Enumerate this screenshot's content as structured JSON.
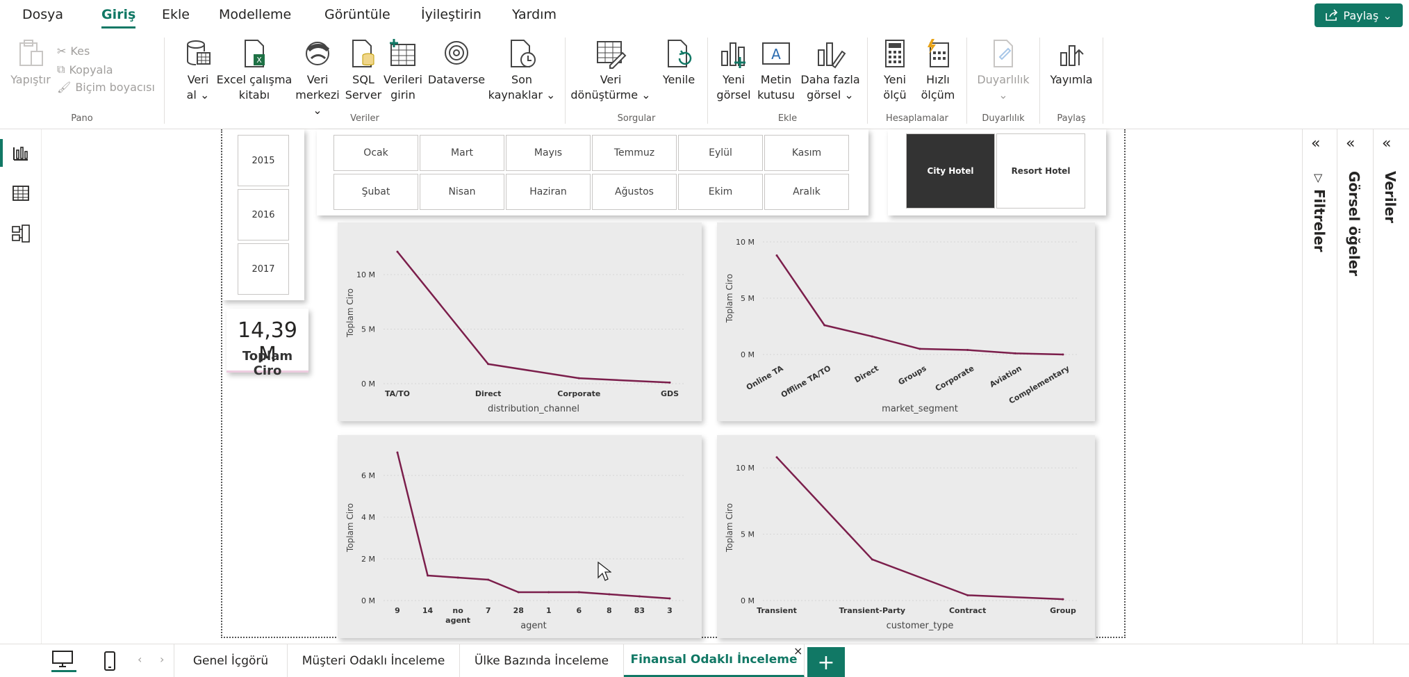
{
  "menu": {
    "items": [
      "Dosya",
      "Giriş",
      "Ekle",
      "Modelleme",
      "Görüntüle",
      "İyileştirin",
      "Yardım"
    ],
    "active_index": 1,
    "share_label": "Paylaş"
  },
  "ribbon": {
    "clipboard": {
      "paste": "Yapıştır",
      "cut": "Kes",
      "copy": "Kopyala",
      "format_painter": "Biçim boyacısı",
      "label": "Pano"
    },
    "data": {
      "get_data": [
        "Veri",
        "al"
      ],
      "excel": [
        "Excel çalışma",
        "kitabı"
      ],
      "hub": [
        "Veri",
        "merkezi"
      ],
      "sql": [
        "SQL",
        "Server"
      ],
      "enter": [
        "Verileri",
        "girin"
      ],
      "dataverse": "Dataverse",
      "recent": [
        "Son",
        "kaynaklar"
      ],
      "label": "Veriler"
    },
    "queries": {
      "transform": [
        "Veri",
        "dönüştürme"
      ],
      "refresh": "Yenile",
      "label": "Sorgular"
    },
    "insert": {
      "new_visual": [
        "Yeni",
        "görsel"
      ],
      "text_box": [
        "Metin",
        "kutusu"
      ],
      "more_visuals": [
        "Daha fazla",
        "görsel"
      ],
      "label": "Ekle"
    },
    "calc": {
      "new_measure": [
        "Yeni",
        "ölçü"
      ],
      "quick_measure": [
        "Hızlı",
        "ölçüm"
      ],
      "label": "Hesaplamalar"
    },
    "sensitivity": {
      "btn": "Duyarlılık",
      "label": "Duyarlılık"
    },
    "share": {
      "publish": "Yayımla",
      "label": "Paylaş"
    }
  },
  "slicers": {
    "years": [
      "2015",
      "2016",
      "2017"
    ],
    "months": [
      "Ocak",
      "Mart",
      "Mayıs",
      "Temmuz",
      "Eylül",
      "Kasım",
      "Şubat",
      "Nisan",
      "Haziran",
      "Ağustos",
      "Ekim",
      "Aralık"
    ],
    "hotels": [
      "City Hotel",
      "Resort Hotel"
    ],
    "selected_hotel": "City Hotel"
  },
  "kpi": {
    "value": "14,39 M",
    "label": "Toplam Ciro"
  },
  "panes": {
    "filters": "Filtreler",
    "visuals": "Görsel öğeler",
    "data": "Veriler"
  },
  "tabs": [
    "Genel İçgörü",
    "Müşteri Odaklı İnceleme",
    "Ülke Bazında İnceleme",
    "Finansal Odaklı İnceleme"
  ],
  "active_tab": 3,
  "colors": {
    "accent": "#117865",
    "line": "#7b1e4b",
    "chart_bg": "#ebebeb"
  },
  "chart_data": [
    {
      "type": "line",
      "xlabel": "distribution_channel",
      "ylabel": "Toplam Ciro",
      "categories": [
        "TA/TO",
        "Direct",
        "Corporate",
        "GDS"
      ],
      "values": [
        12.1,
        1.8,
        0.5,
        0.1
      ],
      "yticks": [
        "0 M",
        "5 M",
        "10 M"
      ],
      "ylim": [
        0,
        13
      ]
    },
    {
      "type": "line",
      "xlabel": "market_segment",
      "ylabel": "Toplam Ciro",
      "categories": [
        "Online TA",
        "Offline TA/TO",
        "Direct",
        "Groups",
        "Corporate",
        "Aviation",
        "Complementary"
      ],
      "values": [
        8.8,
        2.6,
        1.6,
        0.5,
        0.4,
        0.1,
        0.0
      ],
      "yticks": [
        "0 M",
        "5 M",
        "10 M"
      ],
      "ylim": [
        0,
        10
      ]
    },
    {
      "type": "line",
      "xlabel": "agent",
      "ylabel": "Toplam Ciro",
      "categories": [
        "9",
        "14",
        "no agent",
        "7",
        "28",
        "1",
        "6",
        "8",
        "83",
        "3"
      ],
      "values": [
        7.1,
        1.2,
        1.1,
        1.0,
        0.4,
        0.4,
        0.4,
        0.3,
        0.2,
        0.1
      ],
      "yticks": [
        "0 M",
        "2 M",
        "4 M",
        "6 M"
      ],
      "ylim": [
        0,
        7
      ]
    },
    {
      "type": "line",
      "xlabel": "customer_type",
      "ylabel": "Toplam Ciro",
      "categories": [
        "Transient",
        "Transient-Party",
        "Contract",
        "Group"
      ],
      "values": [
        10.8,
        3.1,
        0.4,
        0.1
      ],
      "yticks": [
        "0 M",
        "5 M",
        "10 M"
      ],
      "ylim": [
        0,
        11
      ]
    }
  ]
}
